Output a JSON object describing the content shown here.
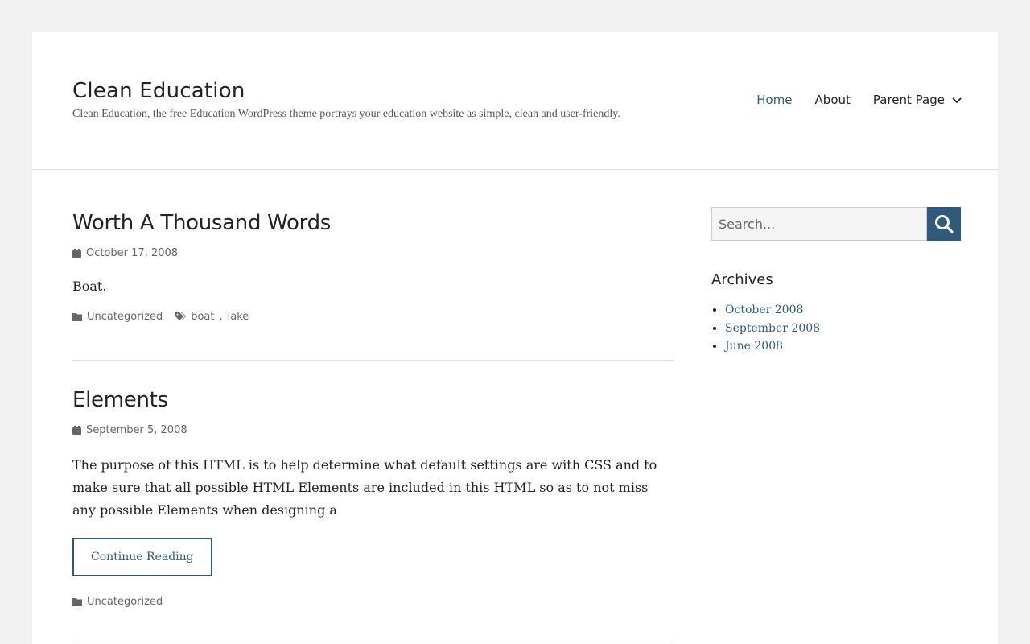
{
  "site": {
    "title": "Clean Education",
    "description": "Clean Education, the free Education WordPress theme portrays your education website as simple, clean and user-friendly."
  },
  "nav": {
    "items": [
      {
        "label": "Home"
      },
      {
        "label": "About"
      },
      {
        "label": "Parent Page"
      }
    ]
  },
  "posts": [
    {
      "title": "Worth A Thousand Words",
      "date": "October 17, 2008",
      "excerpt": "Boat.",
      "category": "Uncategorized",
      "tags": [
        "boat",
        "lake"
      ]
    },
    {
      "title": "Elements",
      "date": "September 5, 2008",
      "excerpt": "The purpose of this HTML is to help determine what default settings are with CSS and to make sure that all possible HTML Elements are included in this HTML so as to not miss any possible Elements when designing a",
      "continue_label": "Continue Reading",
      "category": "Uncategorized"
    }
  ],
  "sidebar": {
    "search_placeholder": "Search...",
    "archives_title": "Archives",
    "archives": [
      {
        "label": "October 2008"
      },
      {
        "label": "September 2008"
      },
      {
        "label": "June 2008"
      }
    ]
  },
  "colors": {
    "accent": "#2f5a7a",
    "page_bg": "#f1f1f1",
    "card_bg": "#ffffff"
  }
}
